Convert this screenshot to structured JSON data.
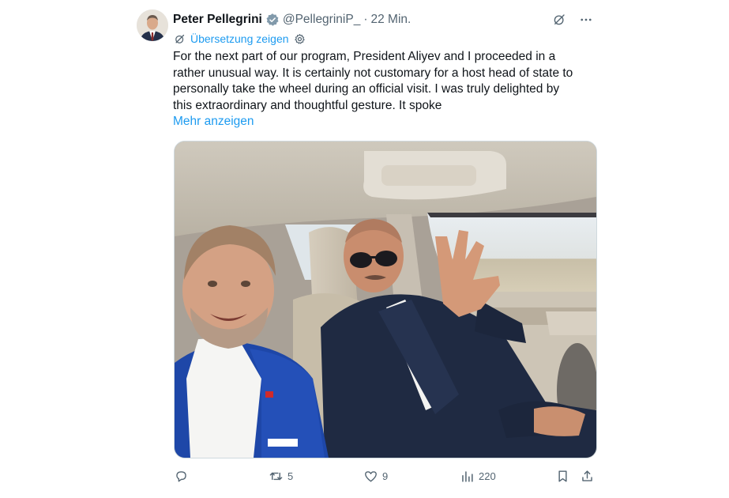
{
  "tweet": {
    "author": {
      "display_name": "Peter Pellegrini",
      "handle": "@PellegriniP_",
      "verified_icon": "verified-badge-icon"
    },
    "separator": "·",
    "time": "22 Min.",
    "translate_label": "Übersetzung zeigen",
    "text": "For the next part of our program, President Aliyev and I proceeded in a\nrather unusual way. It is certainly not customary for a host head of state to\npersonally take the wheel during an official visit. I was truly delighted by\nthis extraordinary and thoughtful gesture. It spoke",
    "show_more": "Mehr anzeigen",
    "media": {
      "type": "photo"
    },
    "metrics": {
      "reposts": "5",
      "likes": "9",
      "views": "220"
    }
  },
  "colors": {
    "link": "#1d9bf0",
    "secondary_text": "#536471",
    "primary_text": "#0f1419"
  }
}
